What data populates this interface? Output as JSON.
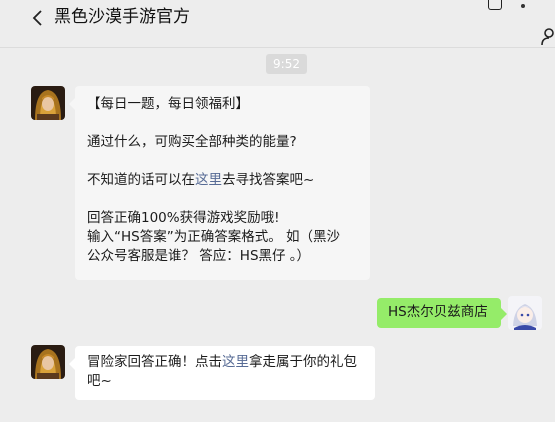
{
  "header": {
    "title": "黑色沙漠手游官方"
  },
  "time_label": "9:52",
  "messages": {
    "m1": {
      "line1": "【每日一题，每日领福利】",
      "line2": "通过什么，可购买全部种类的能量?",
      "line3_pre": "不知道的话可以在",
      "line3_link": "这里",
      "line3_post": "去寻找答案吧~",
      "line4": "回答正确100%获得游戏奖励哦!",
      "line5": "输入“HS答案”为正确答案格式。 如（黑沙",
      "line6": "公众号客服是谁？ 答应：HS黑仔 。）"
    },
    "m2": {
      "text": "HS杰尔贝兹商店"
    },
    "m3": {
      "line1_pre": "冒险家回答正确！点击",
      "line1_link": "这里",
      "line1_post": "拿走属于你的礼包",
      "line2": "吧~"
    }
  },
  "colors": {
    "background": "#ededed",
    "incoming_bubble": "#f6f6f6",
    "outgoing_bubble": "#95ec69",
    "link": "#576b95",
    "time_badge": "#dadada"
  },
  "icons": {
    "back": "chevron-left-icon",
    "more": "more-icon",
    "trash": "trash-icon",
    "person": "person-icon"
  }
}
